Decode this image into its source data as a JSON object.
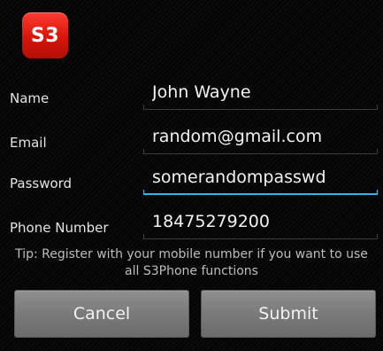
{
  "app": {
    "logo_text": "S3"
  },
  "form": {
    "fields": [
      {
        "label": "Name",
        "value": "John Wayne",
        "focused": false
      },
      {
        "label": "Email",
        "value": "random@gmail.com",
        "focused": false
      },
      {
        "label": "Password",
        "value": "somerandompasswd",
        "focused": true
      },
      {
        "label": "Phone Number",
        "value": "18475279200",
        "focused": false
      }
    ],
    "tip_line1": "Tip: Register with your mobile number if you want to use",
    "tip_line2": "all S3Phone functions"
  },
  "buttons": {
    "cancel_label": "Cancel",
    "submit_label": "Submit"
  },
  "colors": {
    "focus_accent": "#33b5e5",
    "logo_red": "#e0190f"
  }
}
